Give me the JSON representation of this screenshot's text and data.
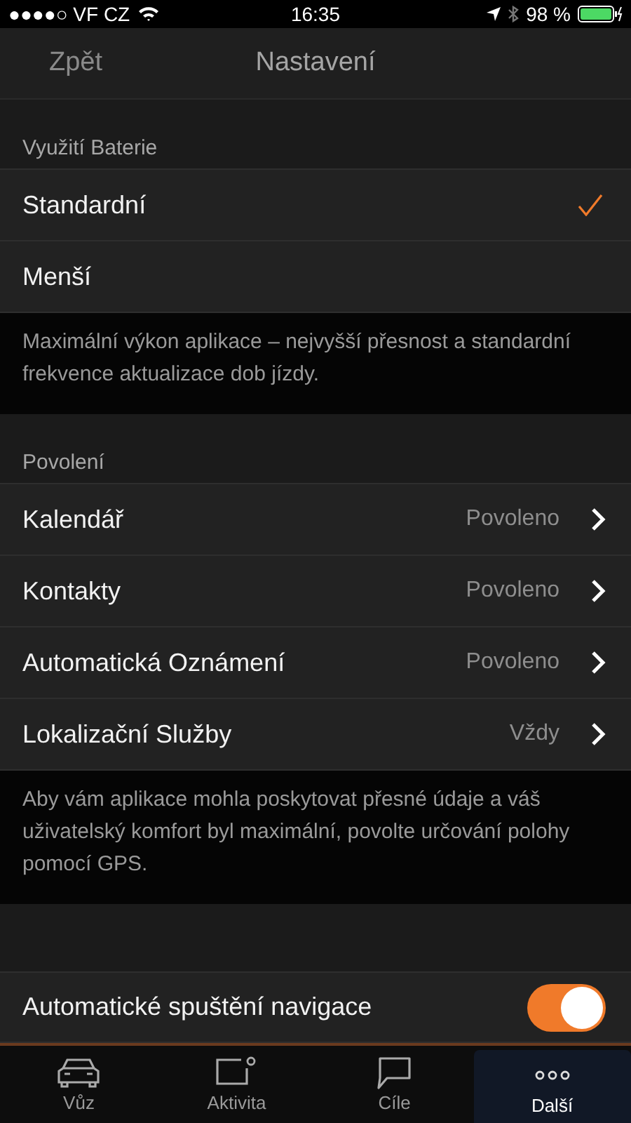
{
  "status_bar": {
    "carrier": "●●●●○ VF CZ",
    "time": "16:35",
    "battery": "98 %"
  },
  "nav": {
    "back": "Zpět",
    "title": "Nastavení"
  },
  "sections": [
    {
      "header": "Využití Baterie",
      "rows": [
        {
          "kind": "choice",
          "label": "Standardní",
          "selected": true
        },
        {
          "kind": "choice",
          "label": "Menší",
          "selected": false
        }
      ],
      "footer": "Maximální výkon aplikace – nejvyšší přesnost a standardní frekvence aktualizace dob jízdy."
    },
    {
      "header": "Povolení",
      "rows": [
        {
          "kind": "link",
          "label": "Kalendář",
          "value": "Povoleno"
        },
        {
          "kind": "link",
          "label": "Kontakty",
          "value": "Povoleno"
        },
        {
          "kind": "link",
          "label": "Automatická Oznámení",
          "value": "Povoleno"
        },
        {
          "kind": "link",
          "label": "Lokalizační Služby",
          "value": "Vždy"
        }
      ],
      "footer": "Aby vám aplikace mohla poskytovat přesné údaje a váš uživatelský komfort byl maximální, povolte určování polohy pomocí GPS."
    },
    {
      "rows": [
        {
          "kind": "toggle",
          "label": "Automatické spuštění navigace",
          "on": true
        }
      ]
    }
  ],
  "tabs": [
    {
      "kind": "car",
      "label": "Vůz",
      "selected": false
    },
    {
      "kind": "activity",
      "label": "Aktivita",
      "selected": false
    },
    {
      "kind": "chat",
      "label": "Cíle",
      "selected": false
    },
    {
      "kind": "more",
      "label": "Další",
      "selected": true
    }
  ]
}
